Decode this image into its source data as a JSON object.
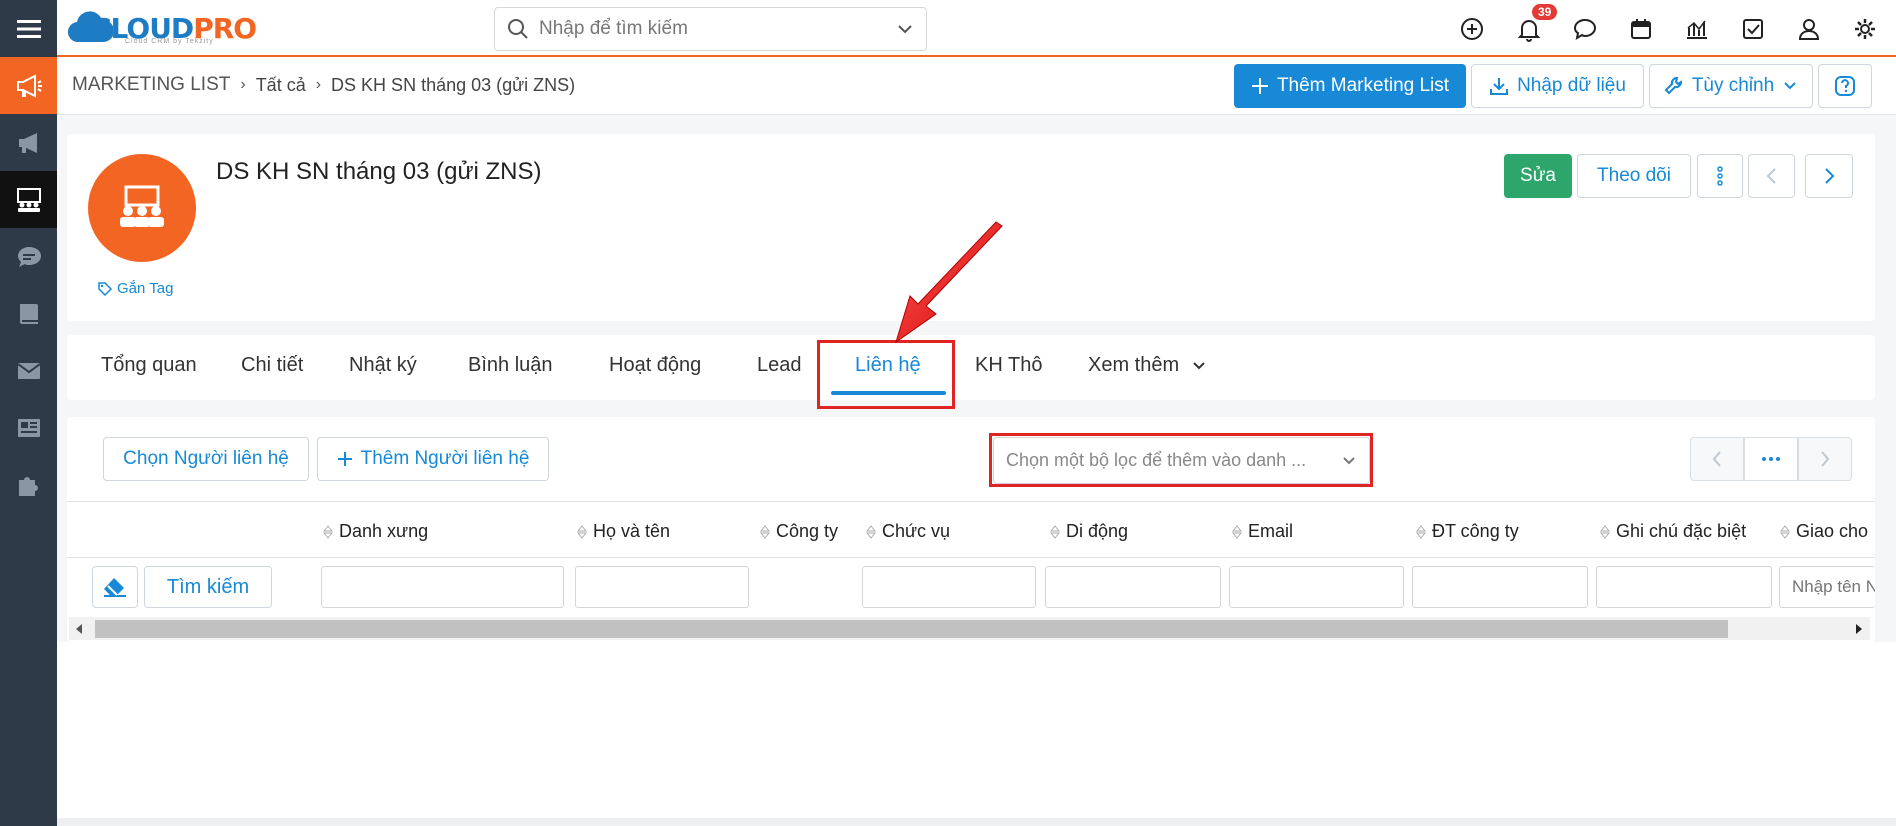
{
  "topbar": {
    "logo_main": "CLOUD",
    "logo_pro": "PRO",
    "logo_sub": "Cloud CRM by Tekzity",
    "search_placeholder": "Nhập để tìm kiếm",
    "notification_count": "39"
  },
  "breadcrumb": {
    "root": "MARKETING LIST",
    "level1": "Tất cả",
    "current": "DS KH SN tháng 03 (gửi ZNS)"
  },
  "toolbar": {
    "add_label": "Thêm Marketing List",
    "import_label": "Nhập dữ liệu",
    "customize_label": "Tùy chỉnh"
  },
  "record": {
    "title": "DS KH SN tháng 03 (gửi ZNS)",
    "tag_label": "Gắn Tag",
    "edit_label": "Sửa",
    "follow_label": "Theo dõi"
  },
  "tabs": [
    {
      "label": "Tổng quan"
    },
    {
      "label": "Chi tiết"
    },
    {
      "label": "Nhật ký"
    },
    {
      "label": "Bình luận"
    },
    {
      "label": "Hoạt động"
    },
    {
      "label": "Lead"
    },
    {
      "label": "Liên hệ"
    },
    {
      "label": "KH Thô"
    },
    {
      "label": "Xem thêm"
    }
  ],
  "contacts": {
    "select_label": "Chọn Người liên hệ",
    "add_label": "Thêm Người liên hệ",
    "filter_placeholder": "Chọn một bộ lọc để thêm vào danh ...",
    "search_label": "Tìm kiếm",
    "last_input_placeholder": "Nhập tên N",
    "columns": [
      {
        "label": "Danh xưng"
      },
      {
        "label": "Họ và tên"
      },
      {
        "label": "Công ty"
      },
      {
        "label": "Chức vụ"
      },
      {
        "label": "Di động"
      },
      {
        "label": "Email"
      },
      {
        "label": "ĐT công ty"
      },
      {
        "label": "Ghi chú đặc biệt"
      },
      {
        "label": "Giao cho"
      }
    ]
  },
  "colors": {
    "brand_orange": "#f26522",
    "primary_blue": "#1789d6",
    "success_green": "#2da56b",
    "highlight_red": "#e02424",
    "sidebar_dark": "#2e3a47"
  }
}
